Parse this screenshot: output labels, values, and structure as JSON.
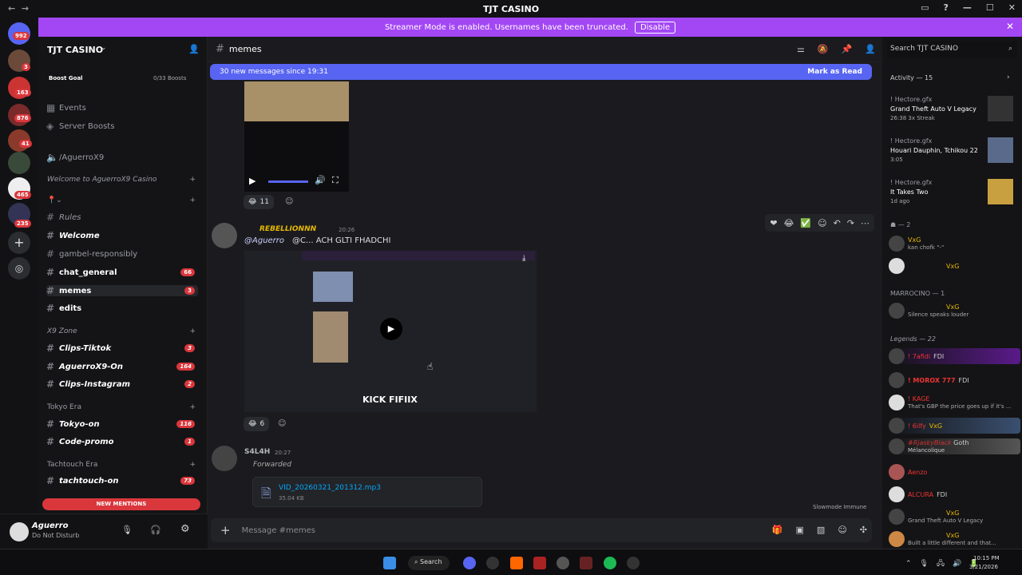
{
  "window": {
    "title": "TJT CASINO"
  },
  "streamer": {
    "text": "Streamer Mode is enabled. Usernames have been truncated.",
    "disable": "Disable"
  },
  "servers": {
    "badges": [
      "992",
      "3",
      "163",
      "876",
      "41",
      "465",
      "235"
    ]
  },
  "server": {
    "name": "TJT CASINO",
    "boost_goal": "Boost Goal",
    "boosts": "0/33 Boosts"
  },
  "sidebar": {
    "events": "Events",
    "server_boosts": "Server Boosts",
    "voice": "/AguerroX9",
    "cat1": "Welcome to AguerroX9 Casino",
    "channels1": [
      {
        "label": "Rules"
      },
      {
        "label": "Welcome"
      },
      {
        "label": "gambel-responsibly"
      },
      {
        "label": "chat_general",
        "count": "66"
      },
      {
        "label": "memes",
        "count": "3"
      },
      {
        "label": "edits"
      }
    ],
    "cat2": "X9 Zone",
    "channels2": [
      {
        "label": "Clips-Tiktok",
        "count": "3"
      },
      {
        "label": "AguerroX9-On",
        "count": "164"
      },
      {
        "label": "Clips-Instagram",
        "count": "2"
      }
    ],
    "cat3": "Tokyo Era",
    "channels3": [
      {
        "label": "Tokyo-on",
        "count": "116"
      },
      {
        "label": "Code-promo",
        "count": "1"
      }
    ],
    "cat4": "Tachtouch Era",
    "channels4": [
      {
        "label": "tachtouch-on",
        "count": "73"
      }
    ],
    "new_mentions": "NEW MENTIONS"
  },
  "user": {
    "name": "Aguerro",
    "status": "Do Not Disturb"
  },
  "channel": {
    "name": "memes",
    "new_messages": "30 new messages since 19:31",
    "mark_read": "Mark as Read",
    "composer_placeholder": "Message #memes",
    "slowmode": "Slowmode Immune"
  },
  "messages": [
    {
      "reaction_count": "11"
    },
    {
      "author": "REBELLIONNN",
      "time": "20:26",
      "mention": "@Aguerro",
      "text": "@C...  ACH GLTI FHADCHI",
      "video_caption": "KICK FIFIIX",
      "reaction_count": "6"
    },
    {
      "author": "S4L4H",
      "time": "20:27",
      "forwarded": "Forwarded",
      "file_name": "VID_20260321_201312.mp3",
      "file_size": "35.04 KB"
    }
  ],
  "members": {
    "search": "Search TJT CASINO",
    "activity": "Activity — 15",
    "activities": [
      {
        "user": "! Hectore.gfx",
        "title": "Grand Theft Auto V Legacy",
        "sub": "26:38  3x Streak"
      },
      {
        "user": "! Hectore.gfx",
        "title": "Houari Dauphin, Tchikou 22",
        "sub": "3:05"
      },
      {
        "user": "! Hectore.gfx",
        "title": "It Takes Two",
        "sub": "1d ago"
      }
    ],
    "group1": "2",
    "g1": [
      {
        "tag": "VxG",
        "status": "kan chofk \"-\""
      },
      {
        "tag": "VxG",
        "status": ""
      }
    ],
    "group2": "MARROCINO — 1",
    "g2": [
      {
        "tag": "VxG",
        "status": "Silence speaks louder"
      }
    ],
    "group3": "Legends — 22",
    "g3": [
      {
        "name": "! 7afidi",
        "tag": "FDI",
        "status": ""
      },
      {
        "name": "! MOROX 777",
        "tag": "FDI",
        "status": ""
      },
      {
        "name": "! KAGE",
        "tag": "",
        "status": "That's GBP the price goes up if it's ..."
      },
      {
        "name": "! 6ilfy",
        "tag": "VxG",
        "status": ""
      },
      {
        "name": "#RjaskyBlack",
        "tag": "Goth",
        "status": "Mélancolique"
      },
      {
        "name": "Aenzo",
        "tag": "",
        "status": ""
      },
      {
        "name": "ALCURA",
        "tag": "FDI",
        "status": ""
      },
      {
        "name": "",
        "tag": "VxG",
        "status": "Grand Theft Auto V Legacy"
      },
      {
        "name": "",
        "tag": "VxG",
        "status": "Built a little different and that..."
      }
    ]
  },
  "taskbar": {
    "search": "Search",
    "time": "10:15 PM",
    "date": "3/21/2026"
  },
  "colors": {
    "accent": "#5865f2",
    "streamer": "#a347f5",
    "badge": "#da373c"
  }
}
